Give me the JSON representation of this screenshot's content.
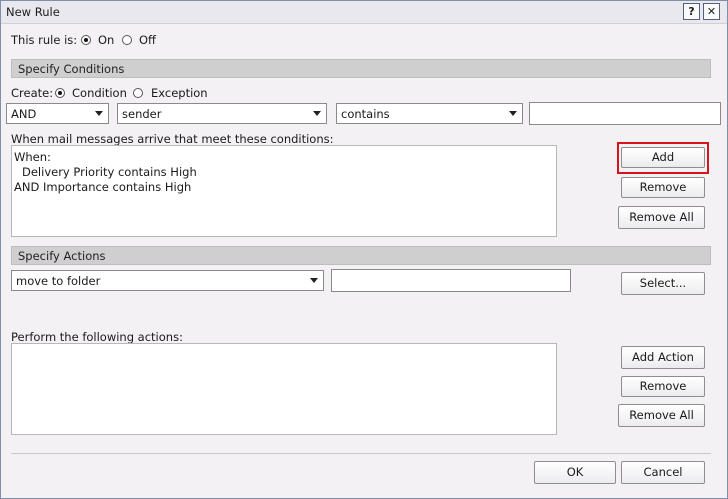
{
  "window": {
    "title": "New Rule",
    "help_label": "?",
    "close_label": "✕"
  },
  "rule_state": {
    "label": "This rule is:",
    "on_label": "On",
    "off_label": "Off",
    "selected": "On"
  },
  "conditions": {
    "header": "Specify Conditions",
    "create_label": "Create:",
    "condition_label": "Condition",
    "exception_label": "Exception",
    "selected": "Condition",
    "logic_select": "AND",
    "field_select": "sender",
    "operator_select": "contains",
    "value_input": "",
    "list_label": "When mail messages arrive that meet these conditions:",
    "list_lines": [
      "When:",
      "Delivery Priority contains High",
      "AND Importance contains High"
    ],
    "add_button": "Add",
    "remove_button": "Remove",
    "remove_all_button": "Remove All"
  },
  "actions": {
    "header": "Specify Actions",
    "action_select": "move to folder",
    "folder_input": "",
    "select_button": "Select...",
    "list_label": "Perform the following actions:",
    "add_action_button": "Add Action",
    "remove_button": "Remove",
    "remove_all_button": "Remove All"
  },
  "footer": {
    "ok_button": "OK",
    "cancel_button": "Cancel"
  },
  "colors": {
    "highlight": "#d6141a",
    "section_header": "#cfcfcf",
    "dialog_bg": "#f4f1f4"
  }
}
